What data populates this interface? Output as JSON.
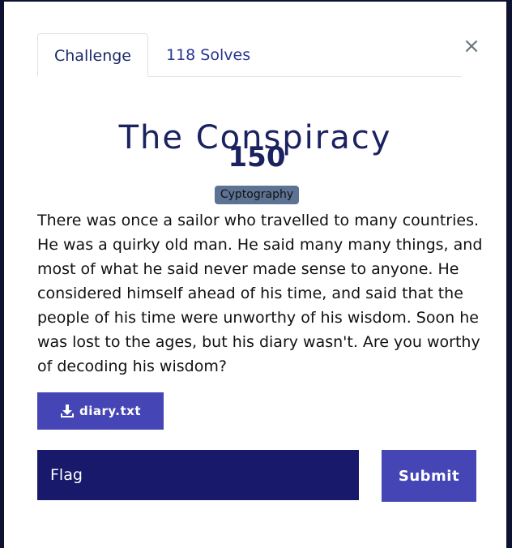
{
  "tabs": [
    {
      "label": "Challenge",
      "active": true
    },
    {
      "label": "118 Solves",
      "active": false
    }
  ],
  "close": {
    "label": "×"
  },
  "challenge": {
    "title": "The Conspiracy",
    "points": "150",
    "category": "Cyptography",
    "description": "There was once a sailor who travelled to many countries. He was a quirky old man. He said many many things, and most of what he said never made sense to anyone. He considered himself ahead of his time, and said that the people of his time were unworthy of his wisdom. Soon he was lost to the ages, but his diary wasn't. Are you worthy of decoding his wisdom?"
  },
  "file": {
    "label": "diary.txt",
    "icon": "download-icon"
  },
  "flag": {
    "placeholder": "Flag",
    "value": ""
  },
  "submit": {
    "label": "Submit"
  },
  "colors": {
    "title": "#1b2260",
    "tab_text": "#283593",
    "button": "#4545b5",
    "input_bg": "#19196b",
    "badge_bg": "#5d7394"
  }
}
